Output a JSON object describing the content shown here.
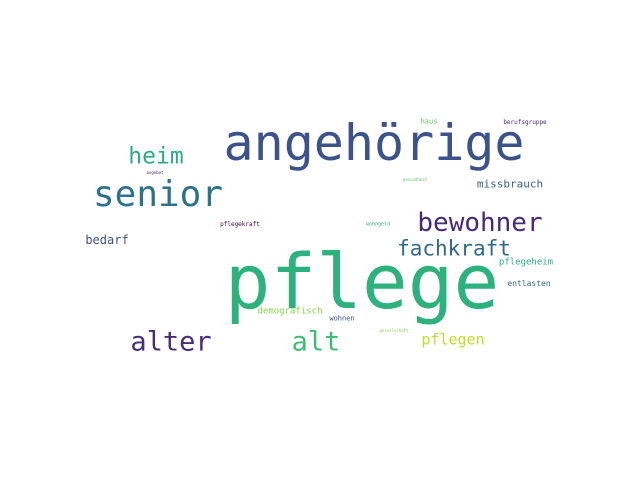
{
  "words": [
    {
      "text": "pflege",
      "color": "#2db27d"
    },
    {
      "text": "angehörige",
      "color": "#3b528b"
    },
    {
      "text": "senior",
      "color": "#2c728e"
    },
    {
      "text": "bewohner",
      "color": "#482878"
    },
    {
      "text": "fachkraft",
      "color": "#31688e"
    },
    {
      "text": "heim",
      "color": "#29af7f"
    },
    {
      "text": "alter",
      "color": "#472d7b"
    },
    {
      "text": "alt",
      "color": "#3fbc73"
    },
    {
      "text": "pflegen",
      "color": "#bddf26"
    },
    {
      "text": "bedarf",
      "color": "#3b528b"
    },
    {
      "text": "missbrauch",
      "color": "#31688e"
    },
    {
      "text": "pflegeheim",
      "color": "#27ad81"
    },
    {
      "text": "entlasten",
      "color": "#31688e"
    },
    {
      "text": "demografisch",
      "color": "#86d549"
    },
    {
      "text": "wohnen",
      "color": "#3b528b"
    },
    {
      "text": "haus",
      "color": "#5ec962"
    },
    {
      "text": "berufsgruppe",
      "color": "#472d7b"
    },
    {
      "text": "pflegekraft",
      "color": "#440154"
    },
    {
      "text": "wohngeld",
      "color": "#35b779"
    },
    {
      "text": "gesundheit",
      "color": "#5ec962"
    },
    {
      "text": "angebot",
      "color": "#472d7b"
    },
    {
      "text": "gesellschaft",
      "color": "#7ad151"
    }
  ]
}
